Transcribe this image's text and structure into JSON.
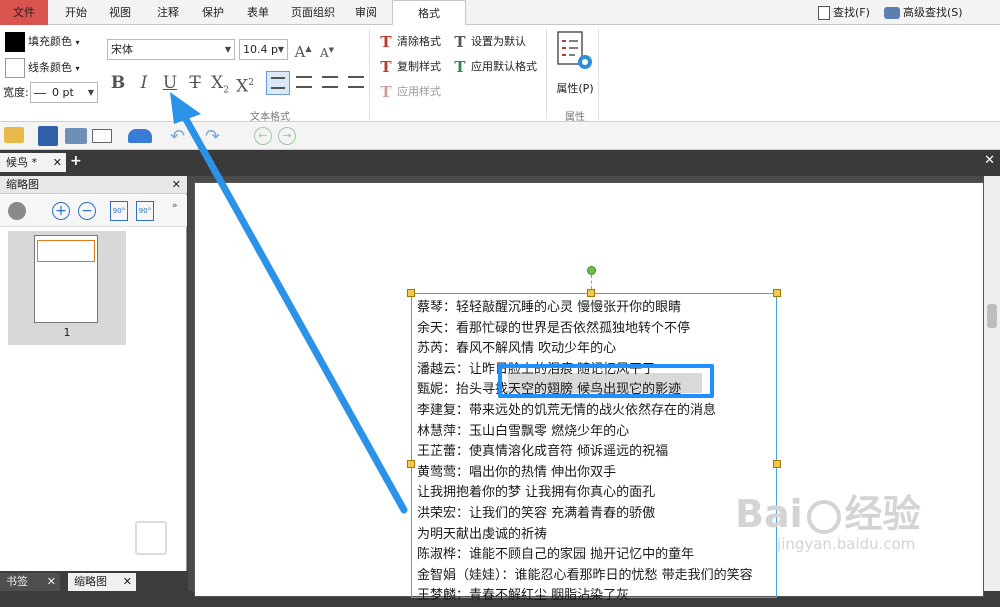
{
  "ribbon_tabs": [
    "文件",
    "开始",
    "视图",
    "注释",
    "保护",
    "表单",
    "页面组织",
    "审阅",
    "格式"
  ],
  "search": {
    "find": "查找(F)",
    "advanced_find": "高级查找(S)"
  },
  "format_group": {
    "fill_color": "填充颜色",
    "line_color": "线条颜色",
    "width_label": "宽度:",
    "width_value": "0 pt",
    "font_name": "宋体",
    "font_size": "10.4 p",
    "bold": "B",
    "italic": "I",
    "underline": "U",
    "strike": "T",
    "subscript": "X",
    "sub_mark": "2",
    "superscript": "X",
    "sup_mark": "2",
    "label": "文本格式"
  },
  "style_group": {
    "clear_format": "清除格式",
    "copy_style": "复制样式",
    "apply_style": "应用样式",
    "set_default": "设置为默认",
    "apply_default": "应用默认格式"
  },
  "properties": {
    "label": "属性(P)",
    "group": "属性"
  },
  "doc_tab": "候鸟 *",
  "panel": {
    "title": "缩略图",
    "page_number": "1",
    "tab_bookmarks": "书签",
    "tab_thumbnails": "缩略图"
  },
  "document_lines": [
    "蔡琴：轻轻敲醒沉睡的心灵  慢慢张开你的眼睛",
    "余天：看那忙碌的世界是否依然孤独地转个不停",
    "苏芮：春风不解风情  吹动少年的心",
    "潘越云：让昨日脸上的泪痕  随记忆风干了",
    "甄妮：抬头寻找天空的翅膀  候鸟出现它的影迹",
    "李建复：带来远处的饥荒无情的战火依然存在的消息",
    "林慧萍：玉山白雪飘零  燃烧少年的心",
    "王芷蕾：使真情溶化成音符  倾诉遥远的祝福",
    "黄莺莺：唱出你的热情  伸出你双手",
    "让我拥抱着你的梦  让我拥有你真心的面孔",
    "洪荣宏：让我们的笑容  充满着青春的骄傲",
    "为明天献出虔诚的祈祷",
    "陈淑桦：谁能不顾自己的家园  抛开记忆中的童年",
    "金智娟（娃娃）：谁能忍心看那昨日的忧愁  带走我们的笑容",
    "王梦麟：青春不解红尘  胭脂沾染了灰"
  ],
  "watermark": {
    "brand": "Bai",
    "brand2": "经验",
    "url": "jingyan.baidu.com"
  },
  "colors": {
    "accent": "#1e90ff",
    "file_tab": "#d9534f"
  }
}
